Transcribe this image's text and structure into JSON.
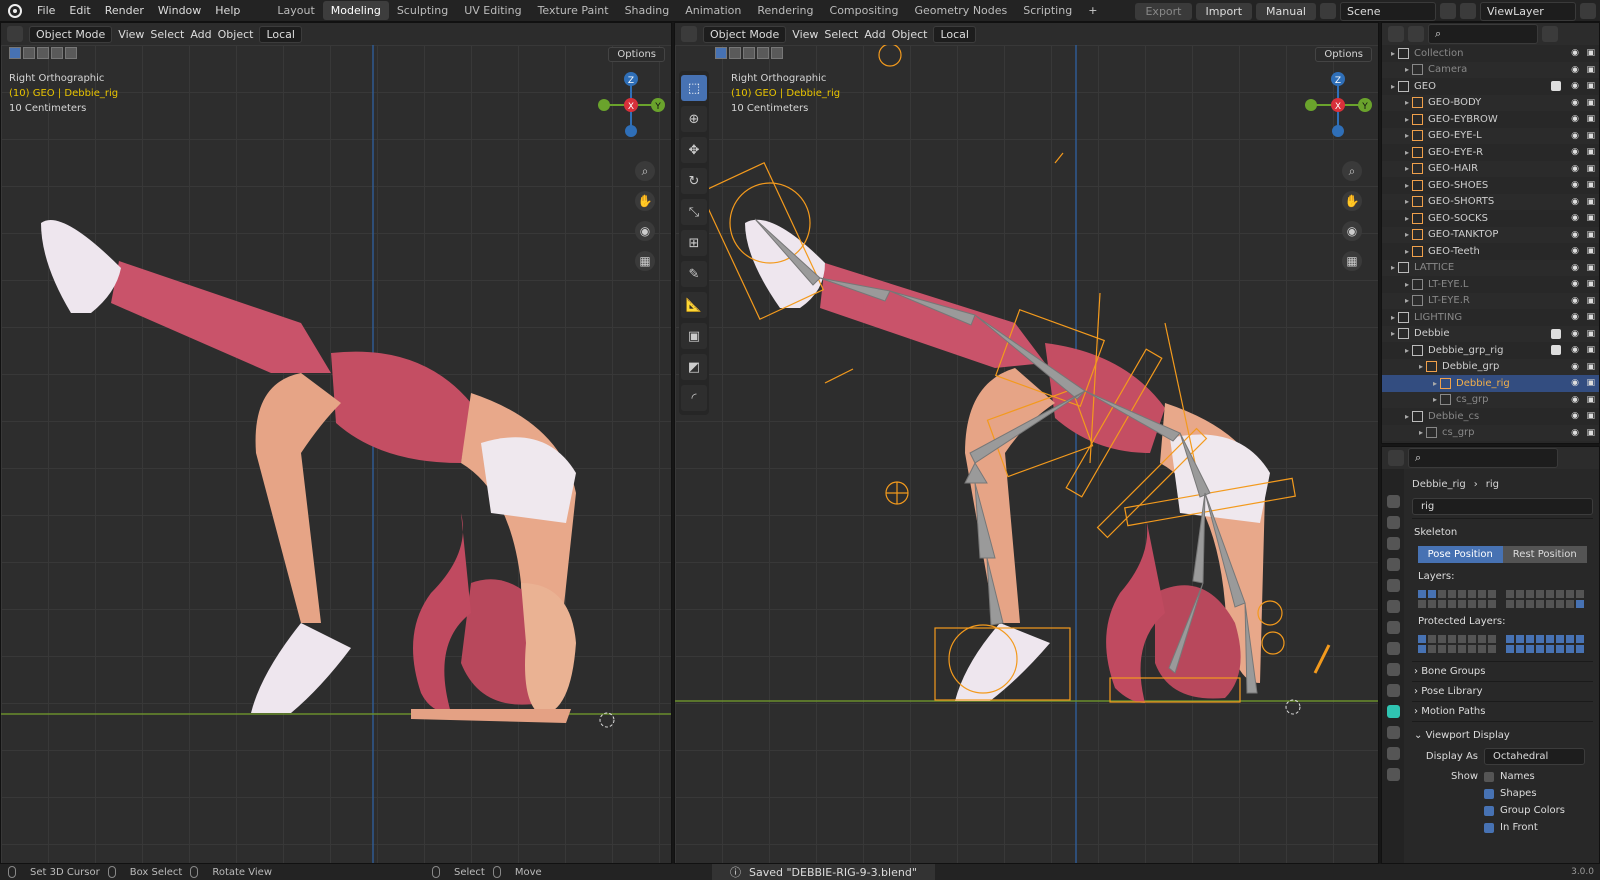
{
  "topbar": {
    "menu": [
      "File",
      "Edit",
      "Render",
      "Window",
      "Help"
    ],
    "workspaces": [
      "Layout",
      "Modeling",
      "Sculpting",
      "UV Editing",
      "Texture Paint",
      "Shading",
      "Animation",
      "Rendering",
      "Compositing",
      "Geometry Nodes",
      "Scripting",
      "+"
    ],
    "active_workspace": "Modeling",
    "export": "Export",
    "import": "Import",
    "manual": "Manual",
    "scene": "Scene",
    "view_layer": "ViewLayer"
  },
  "viewport_left": {
    "mode": "Object Mode",
    "menus": [
      "View",
      "Select",
      "Add",
      "Object"
    ],
    "transform": "Local",
    "options": "Options",
    "view_name": "Right Orthographic",
    "object": "(10) GEO | Debbie_rig",
    "scale": "10 Centimeters",
    "gizmo": {
      "z": "Z",
      "x": "X",
      "y": "Y"
    }
  },
  "viewport_right": {
    "mode": "Object Mode",
    "menus": [
      "View",
      "Select",
      "Add",
      "Object"
    ],
    "transform": "Local",
    "options": "Options",
    "view_name": "Right Orthographic",
    "object": "(10) GEO | Debbie_rig",
    "scale": "10 Centimeters",
    "gizmo": {
      "z": "Z",
      "x": "X",
      "y": "Y"
    }
  },
  "outliner": {
    "rows": [
      {
        "label": "Collection",
        "kind": "collection",
        "indent": 0,
        "dim": true
      },
      {
        "label": "Camera",
        "kind": "camera",
        "indent": 1,
        "dim": true
      },
      {
        "label": "GEO",
        "kind": "collection",
        "indent": 0
      },
      {
        "label": "GEO-BODY",
        "kind": "mesh",
        "indent": 1
      },
      {
        "label": "GEO-EYBROW",
        "kind": "mesh",
        "indent": 1
      },
      {
        "label": "GEO-EYE-L",
        "kind": "mesh",
        "indent": 1
      },
      {
        "label": "GEO-EYE-R",
        "kind": "mesh",
        "indent": 1
      },
      {
        "label": "GEO-HAIR",
        "kind": "mesh",
        "indent": 1
      },
      {
        "label": "GEO-SHOES",
        "kind": "mesh",
        "indent": 1
      },
      {
        "label": "GEO-SHORTS",
        "kind": "mesh",
        "indent": 1
      },
      {
        "label": "GEO-SOCKS",
        "kind": "mesh",
        "indent": 1
      },
      {
        "label": "GEO-TANKTOP",
        "kind": "mesh",
        "indent": 1
      },
      {
        "label": "GEO-Teeth",
        "kind": "mesh",
        "indent": 1
      },
      {
        "label": "LATTICE",
        "kind": "collection",
        "indent": 0,
        "dim": true
      },
      {
        "label": "LT-EYE.L",
        "kind": "lattice",
        "indent": 1,
        "dim": true
      },
      {
        "label": "LT-EYE.R",
        "kind": "lattice",
        "indent": 1,
        "dim": true
      },
      {
        "label": "LIGHTING",
        "kind": "collection",
        "indent": 0,
        "dim": true
      },
      {
        "label": "Debbie",
        "kind": "collection",
        "indent": 0
      },
      {
        "label": "Debbie_grp_rig",
        "kind": "collection",
        "indent": 1
      },
      {
        "label": "Debbie_grp",
        "kind": "armature",
        "indent": 2
      },
      {
        "label": "Debbie_rig",
        "kind": "armature",
        "indent": 3,
        "selected": true
      },
      {
        "label": "cs_grp",
        "kind": "empty",
        "indent": 3,
        "dim": true
      },
      {
        "label": "Debbie_cs",
        "kind": "collection",
        "indent": 1,
        "dim": true
      },
      {
        "label": "cs_grp",
        "kind": "empty",
        "indent": 2,
        "dim": true
      }
    ]
  },
  "properties": {
    "breadcrumb_object": "Debbie_rig",
    "breadcrumb_data": "rig",
    "data_name": "rig",
    "skeleton": "Skeleton",
    "pose_position": "Pose Position",
    "rest_position": "Rest Position",
    "layers_label": "Layers:",
    "protected_label": "Protected Layers:",
    "bone_groups": "Bone Groups",
    "pose_library": "Pose Library",
    "motion_paths": "Motion Paths",
    "viewport_display": "Viewport Display",
    "display_as_label": "Display As",
    "display_as_value": "Octahedral",
    "show_label": "Show",
    "show_items": [
      {
        "label": "Names",
        "checked": false
      },
      {
        "label": "Shapes",
        "checked": true
      },
      {
        "label": "Group Colors",
        "checked": true
      },
      {
        "label": "In Front",
        "checked": true
      }
    ]
  },
  "statusbar": {
    "set_cursor": "Set 3D Cursor",
    "box_select": "Box Select",
    "rotate_view": "Rotate View",
    "select": "Select",
    "move": "Move",
    "saved": "Saved \"DEBBIE-RIG-9-3.blend\"",
    "version": "3.0.0"
  },
  "colors": {
    "accent": "#4772b3",
    "skin": "#e8a88a",
    "pink": "#c9536a",
    "hair": "#b8485c",
    "shoe": "#efe4ec",
    "rig": "#f39a1d"
  }
}
